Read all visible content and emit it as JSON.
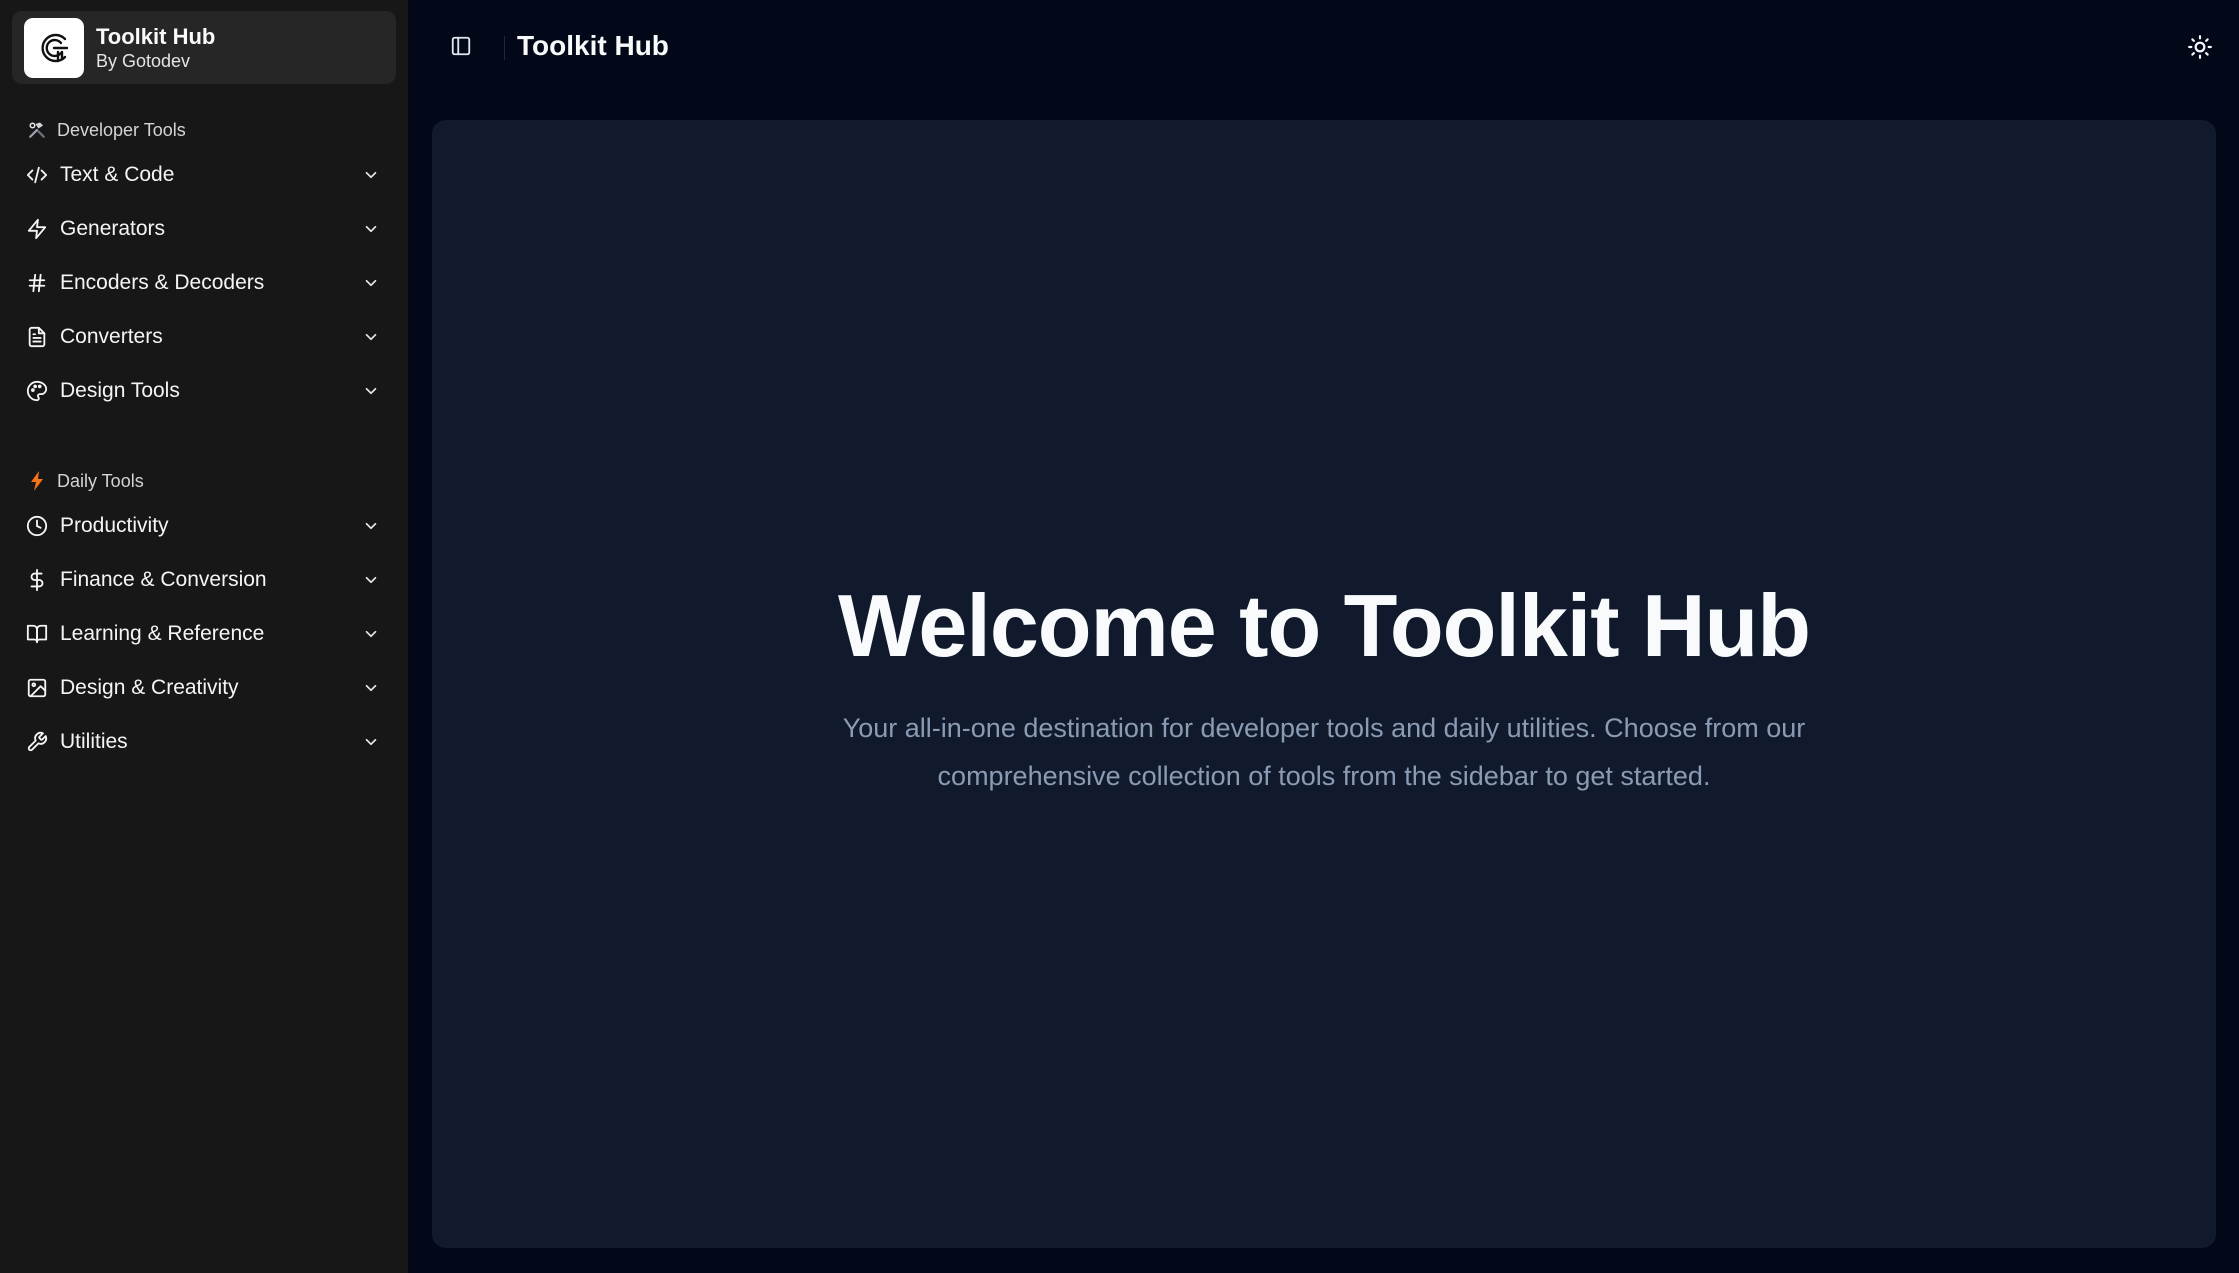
{
  "brand": {
    "title": "Toolkit Hub",
    "subtitle": "By Gotodev"
  },
  "sidebar": {
    "developer_section": {
      "label": "Developer Tools",
      "icon": "hammer-wrench-icon",
      "items": [
        {
          "label": "Text & Code",
          "icon": "code-icon"
        },
        {
          "label": "Generators",
          "icon": "zap-icon"
        },
        {
          "label": "Encoders & Decoders",
          "icon": "hash-icon"
        },
        {
          "label": "Converters",
          "icon": "file-text-icon"
        },
        {
          "label": "Design Tools",
          "icon": "palette-icon"
        }
      ]
    },
    "daily_section": {
      "label": "Daily Tools",
      "icon": "lightning-icon",
      "items": [
        {
          "label": "Productivity",
          "icon": "clock-icon"
        },
        {
          "label": "Finance & Conversion",
          "icon": "dollar-icon"
        },
        {
          "label": "Learning & Reference",
          "icon": "book-icon"
        },
        {
          "label": "Design & Creativity",
          "icon": "image-icon"
        },
        {
          "label": "Utilities",
          "icon": "wrench-icon"
        }
      ]
    }
  },
  "header": {
    "title": "Toolkit Hub"
  },
  "main": {
    "heading": "Welcome to Toolkit Hub",
    "description": "Your all-in-one destination for developer tools and daily utilities. Choose from our comprehensive collection of tools from the sidebar to get started."
  },
  "colors": {
    "page_bg": "#020817",
    "sidebar_bg": "#171717",
    "card_bg": "#111a2c",
    "muted_text": "#8a9bb3",
    "accent_orange": "#f97316"
  }
}
